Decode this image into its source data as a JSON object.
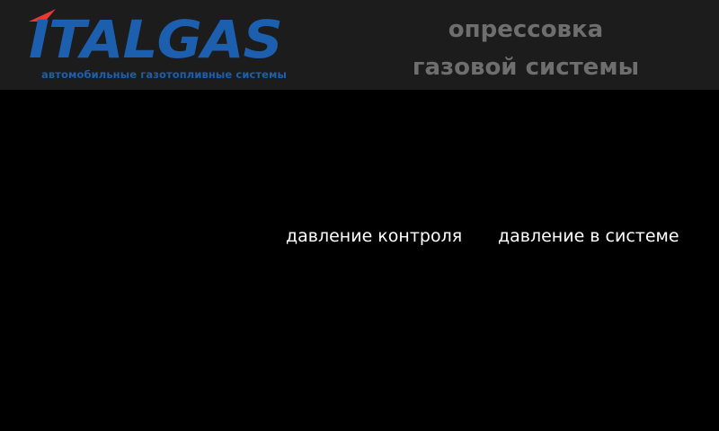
{
  "header": {
    "logo": {
      "brand": "ITALGAS",
      "tagline": "автомобильные газотопливные системы",
      "brand_color": "#1b5fae",
      "flag_color": "#e53935"
    },
    "title_line1": "опрессовка",
    "title_line2": "газовой системы"
  },
  "main": {
    "control_pressure_label": "давление контроля",
    "system_pressure_label": "давление в системе"
  },
  "colors": {
    "background": "#000000",
    "header_background": "#1c1c1c",
    "title_text": "#6e6e6e",
    "label_text": "#ffffff"
  }
}
